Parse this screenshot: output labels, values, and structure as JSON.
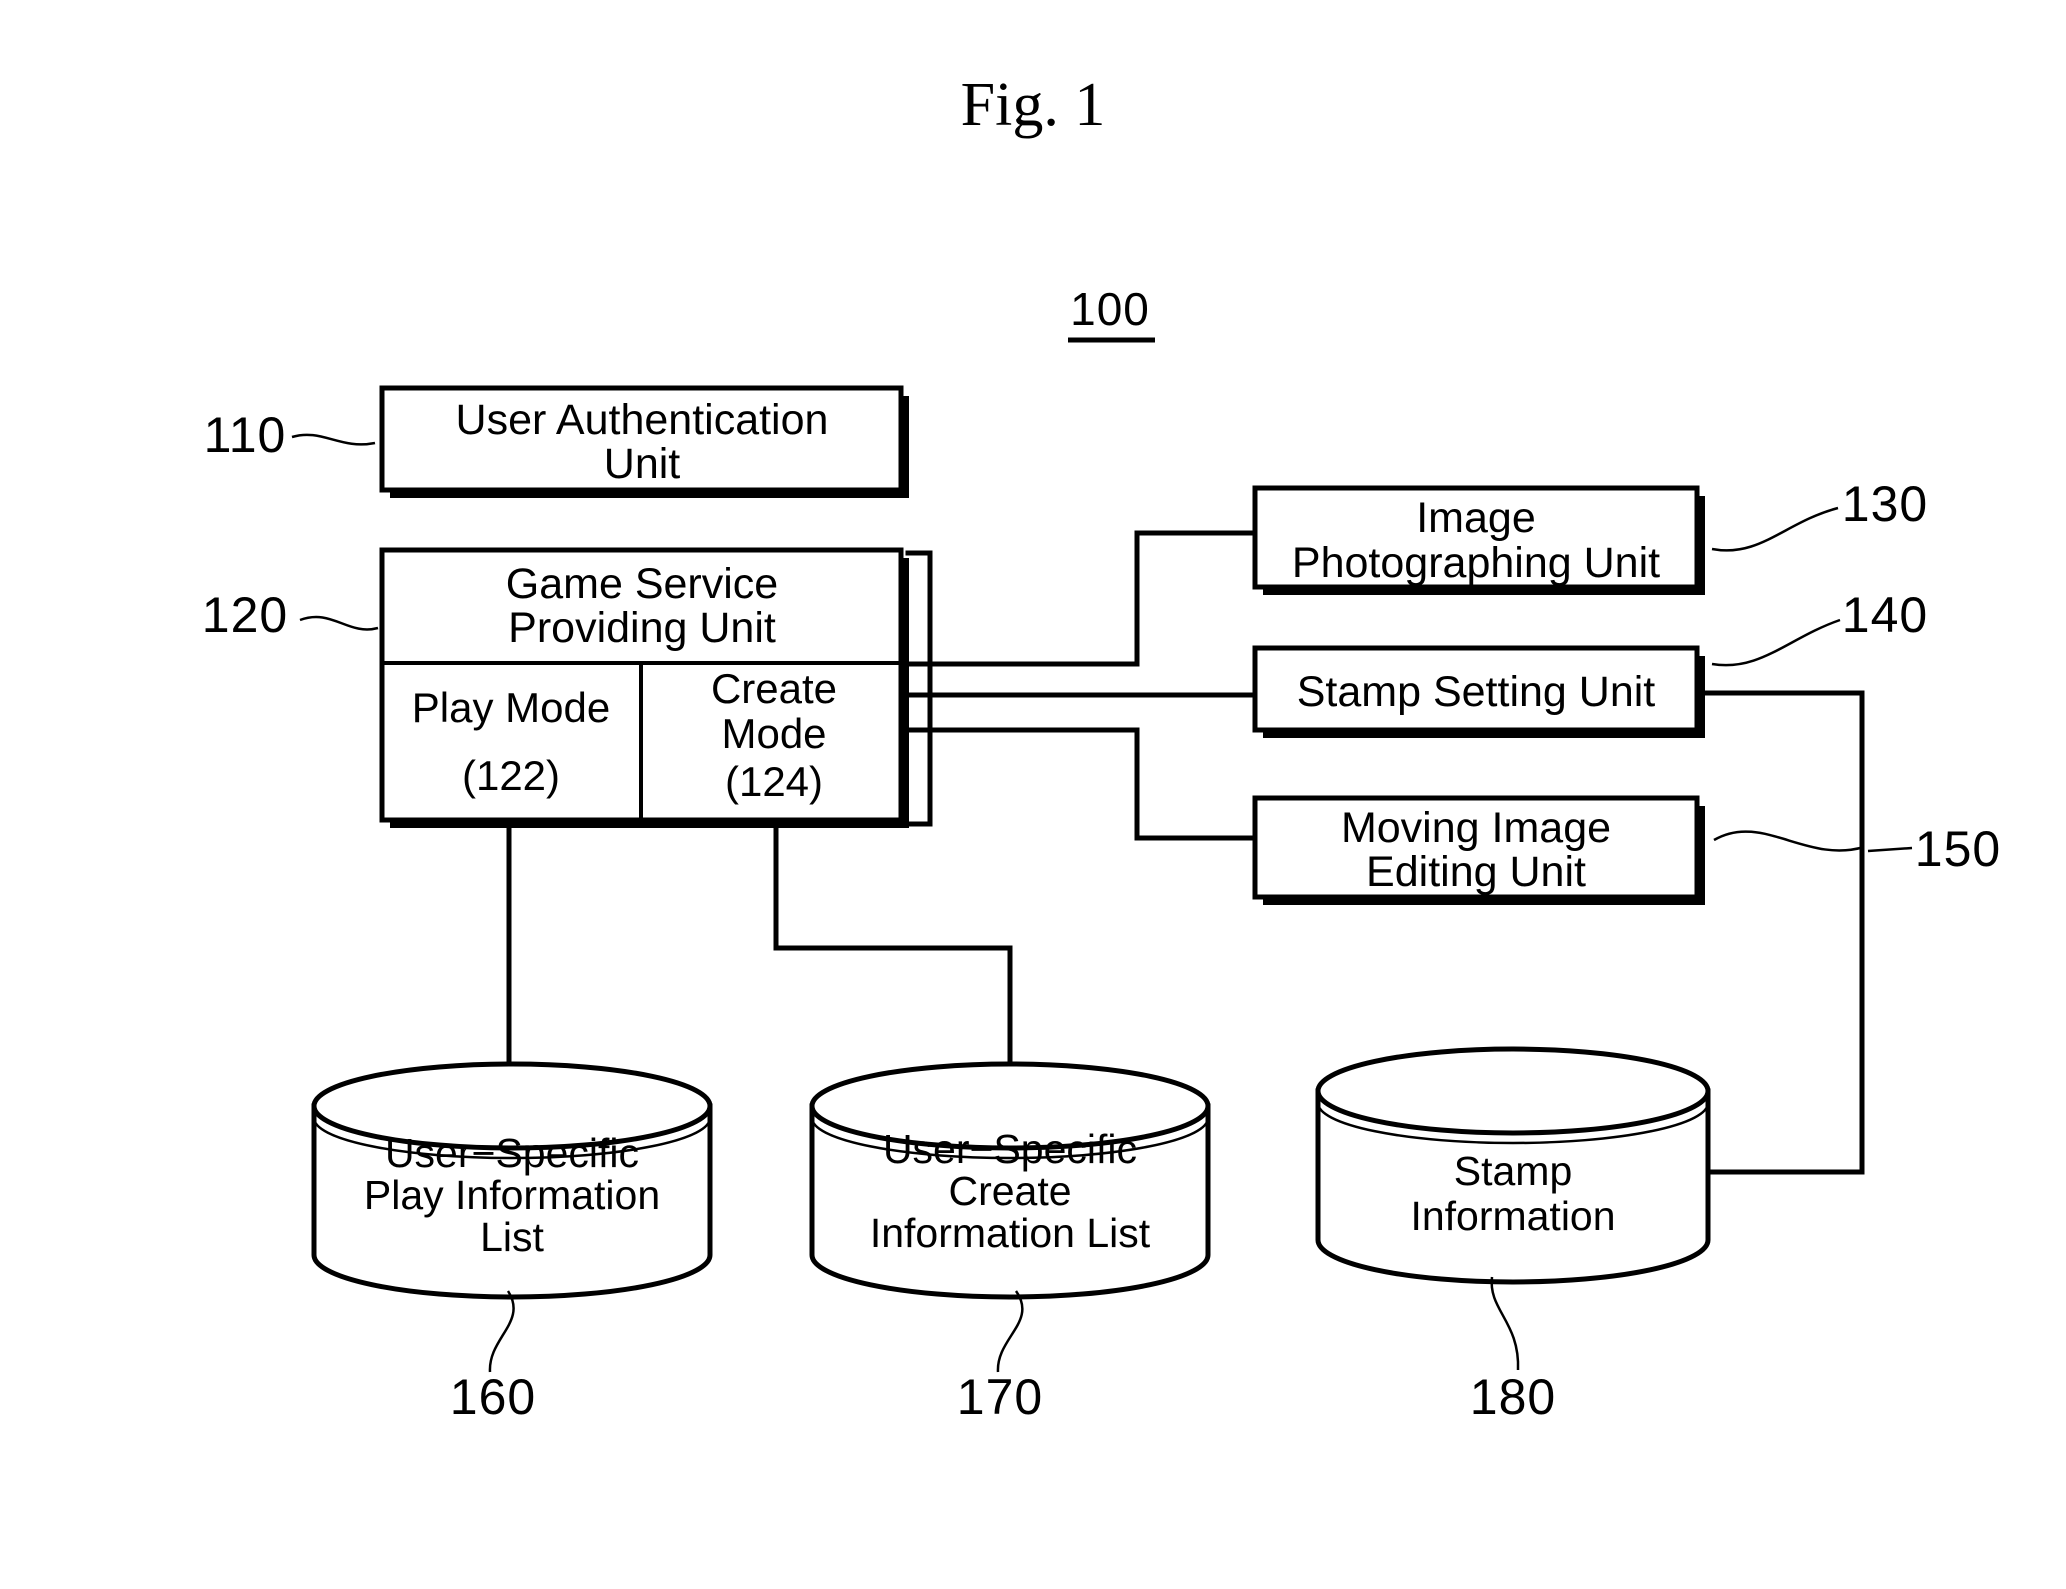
{
  "figure": {
    "title": "Fig. 1",
    "system_reference": "100"
  },
  "blocks": [
    {
      "id": "user-authentication-unit",
      "ref": "110",
      "lines": [
        "User Authentication",
        "Unit"
      ]
    },
    {
      "id": "game-service-providing-unit",
      "ref": "120",
      "lines": [
        "Game Service",
        "Providing Unit"
      ],
      "submodules": [
        {
          "id": "play-mode",
          "lines": [
            "Play Mode",
            "(122)"
          ],
          "ref": "122"
        },
        {
          "id": "create-mode",
          "lines": [
            "Create",
            "Mode",
            "(124)"
          ],
          "ref": "124"
        }
      ]
    },
    {
      "id": "image-photographing-unit",
      "ref": "130",
      "lines": [
        "Image",
        "Photographing Unit"
      ]
    },
    {
      "id": "stamp-setting-unit",
      "ref": "140",
      "lines": [
        "Stamp Setting Unit"
      ]
    },
    {
      "id": "moving-image-editing-unit",
      "ref": "150_connector",
      "lines": [
        "Moving Image",
        "Editing Unit"
      ]
    }
  ],
  "connector_refs": [
    {
      "id": "stamp-link",
      "ref": "150"
    }
  ],
  "datastores": [
    {
      "id": "user-specific-play-information-list",
      "ref": "160",
      "lines": [
        "User−Specific",
        "Play Information",
        "List"
      ]
    },
    {
      "id": "user-specific-create-information-list",
      "ref": "170",
      "lines": [
        "User−Specific",
        "Create",
        "Information List"
      ]
    },
    {
      "id": "stamp-information",
      "ref": "180",
      "lines": [
        "Stamp",
        "Information"
      ]
    }
  ],
  "colors": {
    "ink": "#000000",
    "paper": "#ffffff"
  }
}
